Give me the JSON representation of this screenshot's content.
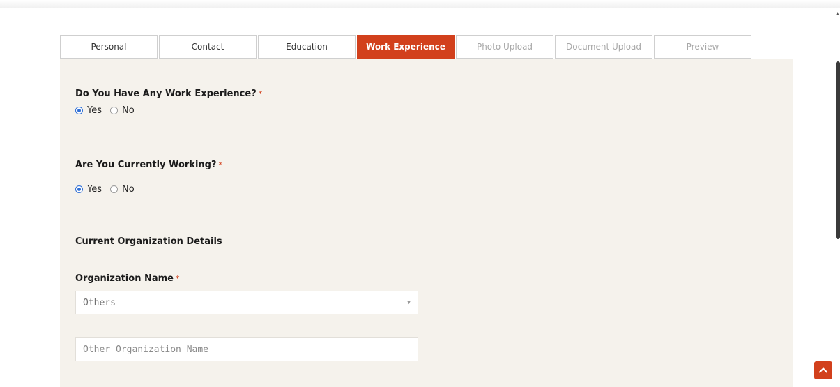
{
  "tabs": [
    {
      "label": "Personal",
      "state": "normal"
    },
    {
      "label": "Contact",
      "state": "normal"
    },
    {
      "label": "Education",
      "state": "normal"
    },
    {
      "label": "Work Experience",
      "state": "active"
    },
    {
      "label": "Photo Upload",
      "state": "disabled"
    },
    {
      "label": "Document Upload",
      "state": "disabled"
    },
    {
      "label": "Preview",
      "state": "disabled"
    }
  ],
  "form": {
    "required_marker": "*",
    "work_experience": {
      "question": "Do You Have Any Work Experience?",
      "options": [
        "Yes",
        "No"
      ],
      "selected": "Yes"
    },
    "currently_working": {
      "question": "Are You Currently Working?",
      "options": [
        "Yes",
        "No"
      ],
      "selected": "Yes"
    },
    "section_title": "Current Organization Details",
    "organization": {
      "label": "Organization Name",
      "selected_value": "Others",
      "other_placeholder": "Other Organization Name"
    }
  },
  "colors": {
    "accent": "#d2401c",
    "panel_background": "#f5f2ec",
    "radio_checked": "#2f6fd6"
  },
  "icons": {
    "select_caret": "caret-down-icon",
    "back_to_top": "chevron-up-icon"
  }
}
